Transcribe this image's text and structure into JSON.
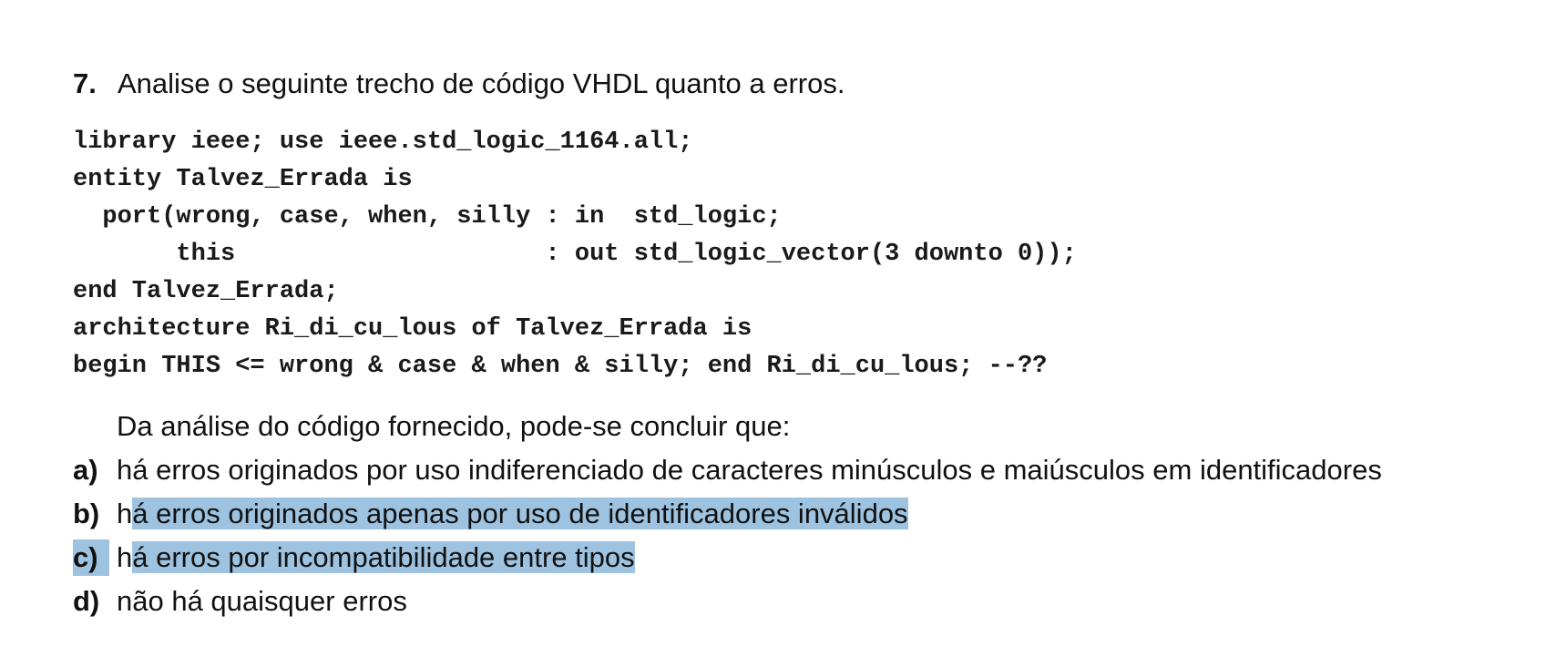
{
  "question": {
    "number": "7.",
    "prompt": "Analise o seguinte trecho de código VHDL quanto a erros."
  },
  "code": [
    "library ieee; use ieee.std_logic_1164.all;",
    "entity Talvez_Errada is",
    "  port(wrong, case, when, silly : in  std_logic;",
    "       this                     : out std_logic_vector(3 downto 0));",
    "end Talvez_Errada;",
    "architecture Ri_di_cu_lous of Talvez_Errada is",
    "begin THIS <= wrong & case & when & silly; end Ri_di_cu_lous; --??"
  ],
  "intro": "Da análise do código fornecido, pode-se concluir que:",
  "options": [
    {
      "letter": "a)",
      "text": "há erros originados por uso indiferenciado de caracteres minúsculos e maiúsculos em identificadores",
      "highlighted": false
    },
    {
      "letter": "b)",
      "text_lead": "h",
      "text_rest": "á erros originados apenas por uso de identificadores inválidos",
      "highlighted": true
    },
    {
      "letter": "c)",
      "text_lead": "h",
      "text_rest": "á erros por incompatibilidade entre tipos",
      "highlighted": true
    },
    {
      "letter": "d)",
      "text": "não há quaisquer erros",
      "highlighted": false
    }
  ],
  "colors": {
    "highlight": "#9ec3e0",
    "text": "#111111"
  }
}
